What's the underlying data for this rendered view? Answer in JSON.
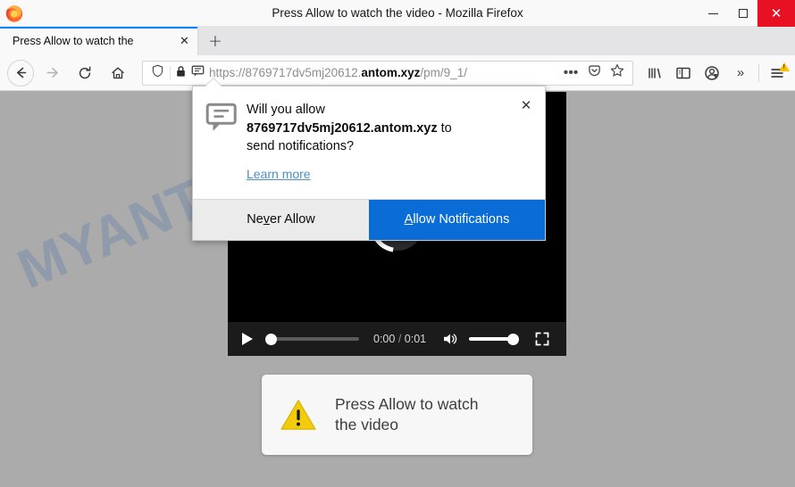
{
  "window": {
    "title": "Press Allow to watch the video - Mozilla Firefox",
    "minimize_label": "Minimize",
    "maximize_label": "Maximize",
    "close_label": "✕",
    "logo_icon": "firefox-logo"
  },
  "tabs": {
    "active": {
      "title": "Press Allow to watch the",
      "close_label": "✕",
      "close_icon": "close-icon"
    },
    "new_tab_label": "+",
    "new_tab_icon": "plus-icon"
  },
  "navigation": {
    "back_icon": "back-arrow-icon",
    "back_glyph": "←",
    "forward_icon": "forward-arrow-icon",
    "forward_glyph": "→",
    "reload_icon": "reload-icon",
    "reload_glyph": "⟳",
    "home_icon": "home-icon"
  },
  "urlbar": {
    "shield_icon": "tracking-protection-shield-icon",
    "lock_icon": "padlock-icon",
    "permission_icon": "notification-bubble-icon",
    "url_prefix": "https://8769717dv5mj20612.",
    "url_host": "antom.xyz",
    "url_path": "/pm/9_1/",
    "page_actions_icon": "ellipsis-icon",
    "page_actions_glyph": "•••",
    "pocket_icon": "pocket-icon",
    "bookmark_icon": "star-icon",
    "bookmark_glyph": "☆"
  },
  "toolbar_right": {
    "library_icon": "library-icon",
    "sidebar_icon": "sidebar-icon",
    "account_icon": "account-warning-icon",
    "overflow_icon": "chevron-double-right-icon",
    "overflow_glyph": "»",
    "menu_icon": "hamburger-menu-icon",
    "menu_warning_icon": "warning-triangle-badge"
  },
  "doorhanger": {
    "icon": "speech-bubble-notification-icon",
    "message_line1": "Will you allow",
    "message_host": "8769717dv5mj20612.antom.xyz",
    "message_line2_tail": " to",
    "message_line3": "send notifications?",
    "learn_more": "Learn more",
    "close_label": "✕",
    "close_icon": "close-icon",
    "never_allow_pre": "Ne",
    "never_allow_key": "v",
    "never_allow_post": "er Allow",
    "allow_key": "A",
    "allow_post": "llow Notifications",
    "primary_color": "#0a6cd6"
  },
  "page": {
    "background_color": "#ababab",
    "watermark": "MYANTISPYWARE.COM",
    "watermark_color": "#2f5fa8"
  },
  "video": {
    "play_overlay_icon": "play-overlay-icon",
    "spinner_icon": "loading-spinner-icon",
    "play_button_icon": "play-icon",
    "current_time": "0:00",
    "time_separator": " / ",
    "duration": "0:01",
    "volume_icon": "volume-on-icon",
    "fullscreen_icon": "fullscreen-icon",
    "progress_percent": 0,
    "volume_percent": 100
  },
  "alert_card": {
    "icon": "warning-triangle-icon",
    "text_line1": "Press Allow to watch",
    "text_line2": "the video",
    "icon_color": "#f2cb0d"
  }
}
